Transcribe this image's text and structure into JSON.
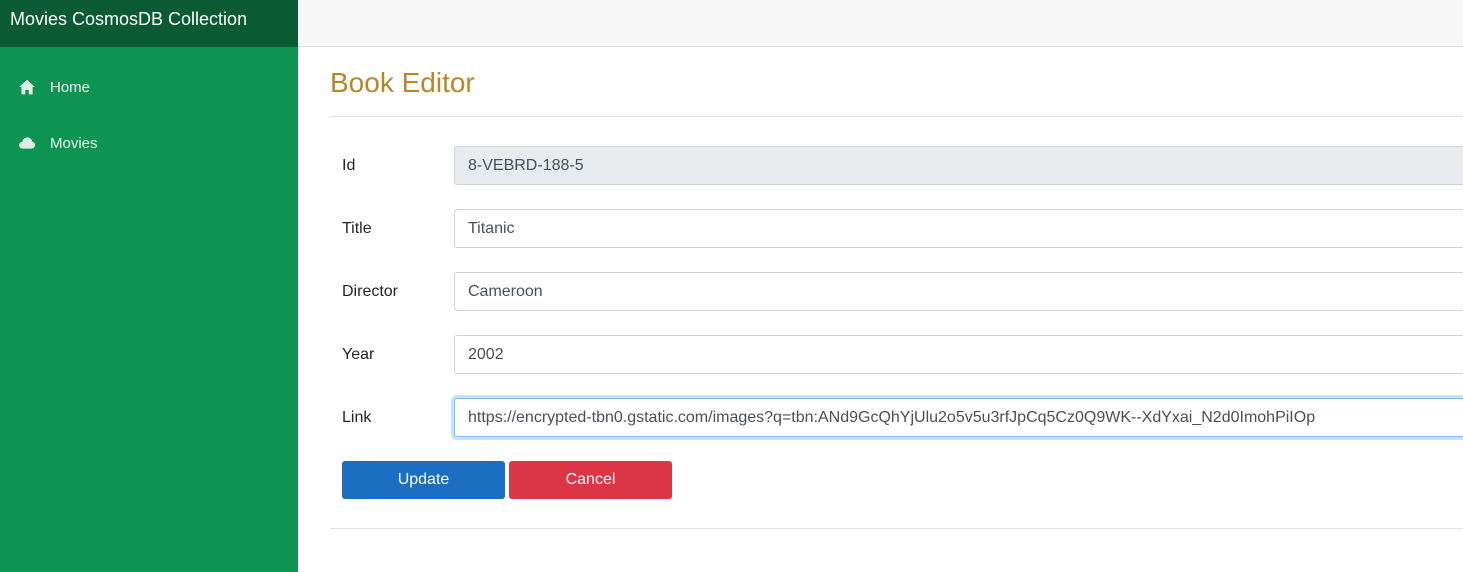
{
  "app": {
    "title": "Movies CosmosDB Collection"
  },
  "sidebar": {
    "items": [
      {
        "label": "Home",
        "icon": "home-icon"
      },
      {
        "label": "Movies",
        "icon": "cloud-icon"
      }
    ]
  },
  "page": {
    "title": "Book Editor"
  },
  "form": {
    "id": {
      "label": "Id",
      "value": "8-VEBRD-188-5"
    },
    "title": {
      "label": "Title",
      "value": "Titanic"
    },
    "director": {
      "label": "Director",
      "value": "Cameroon"
    },
    "year": {
      "label": "Year",
      "value": "2002"
    },
    "link": {
      "label": "Link",
      "value": "https://encrypted-tbn0.gstatic.com/images?q=tbn:ANd9GcQhYjUlu2o5v5u3rfJpCq5Cz0Q9WK--XdYxai_N2d0ImohPiIOp"
    }
  },
  "buttons": {
    "update": "Update",
    "cancel": "Cancel"
  },
  "colors": {
    "sidebar": "#0d9452",
    "brand": "#0a5a33",
    "title": "#b8862b",
    "primary": "#1b6ec2",
    "danger": "#dc3545"
  }
}
